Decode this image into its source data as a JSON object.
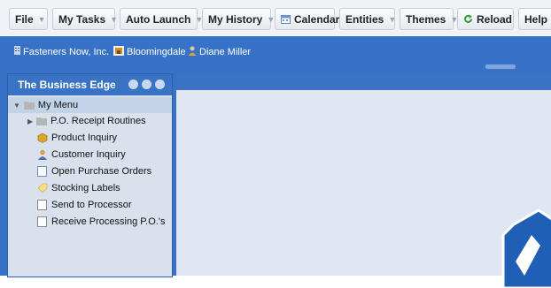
{
  "menubar": {
    "items": [
      {
        "label": "File",
        "has_caret": true
      },
      {
        "label": "My Tasks",
        "has_caret": true
      },
      {
        "label": "Auto Launch",
        "has_caret": true
      },
      {
        "label": "My History",
        "has_caret": true
      },
      {
        "label": "Calendar",
        "icon": "calendar-icon"
      },
      {
        "label": "Entities",
        "has_caret": true
      },
      {
        "label": "Themes",
        "has_caret": true
      },
      {
        "label": "Reload",
        "icon": "reload-icon"
      },
      {
        "label": "Help",
        "has_caret": true
      }
    ]
  },
  "context": {
    "company": "Fasteners Now, Inc.",
    "branch": "Bloomingdale",
    "user": "Diane Miller"
  },
  "panel": {
    "title": "The Business Edge",
    "tree": [
      {
        "label": "My Menu",
        "icon": "folder-icon"
      },
      {
        "label": "P.O. Receipt Routines",
        "icon": "folder-icon"
      },
      {
        "label": "Product Inquiry",
        "icon": "box-icon"
      },
      {
        "label": "Customer Inquiry",
        "icon": "person-icon"
      },
      {
        "label": "Open Purchase Orders",
        "icon": "document-icon"
      },
      {
        "label": "Stocking Labels",
        "icon": "tag-icon"
      },
      {
        "label": "Send to Processor",
        "icon": "document-icon"
      },
      {
        "label": "Receive Processing P.O.'s",
        "icon": "document-icon"
      }
    ]
  },
  "colors": {
    "accent": "#3872c6",
    "panel_bg": "#d8e1ec",
    "main_bg": "#dfe7f2"
  }
}
